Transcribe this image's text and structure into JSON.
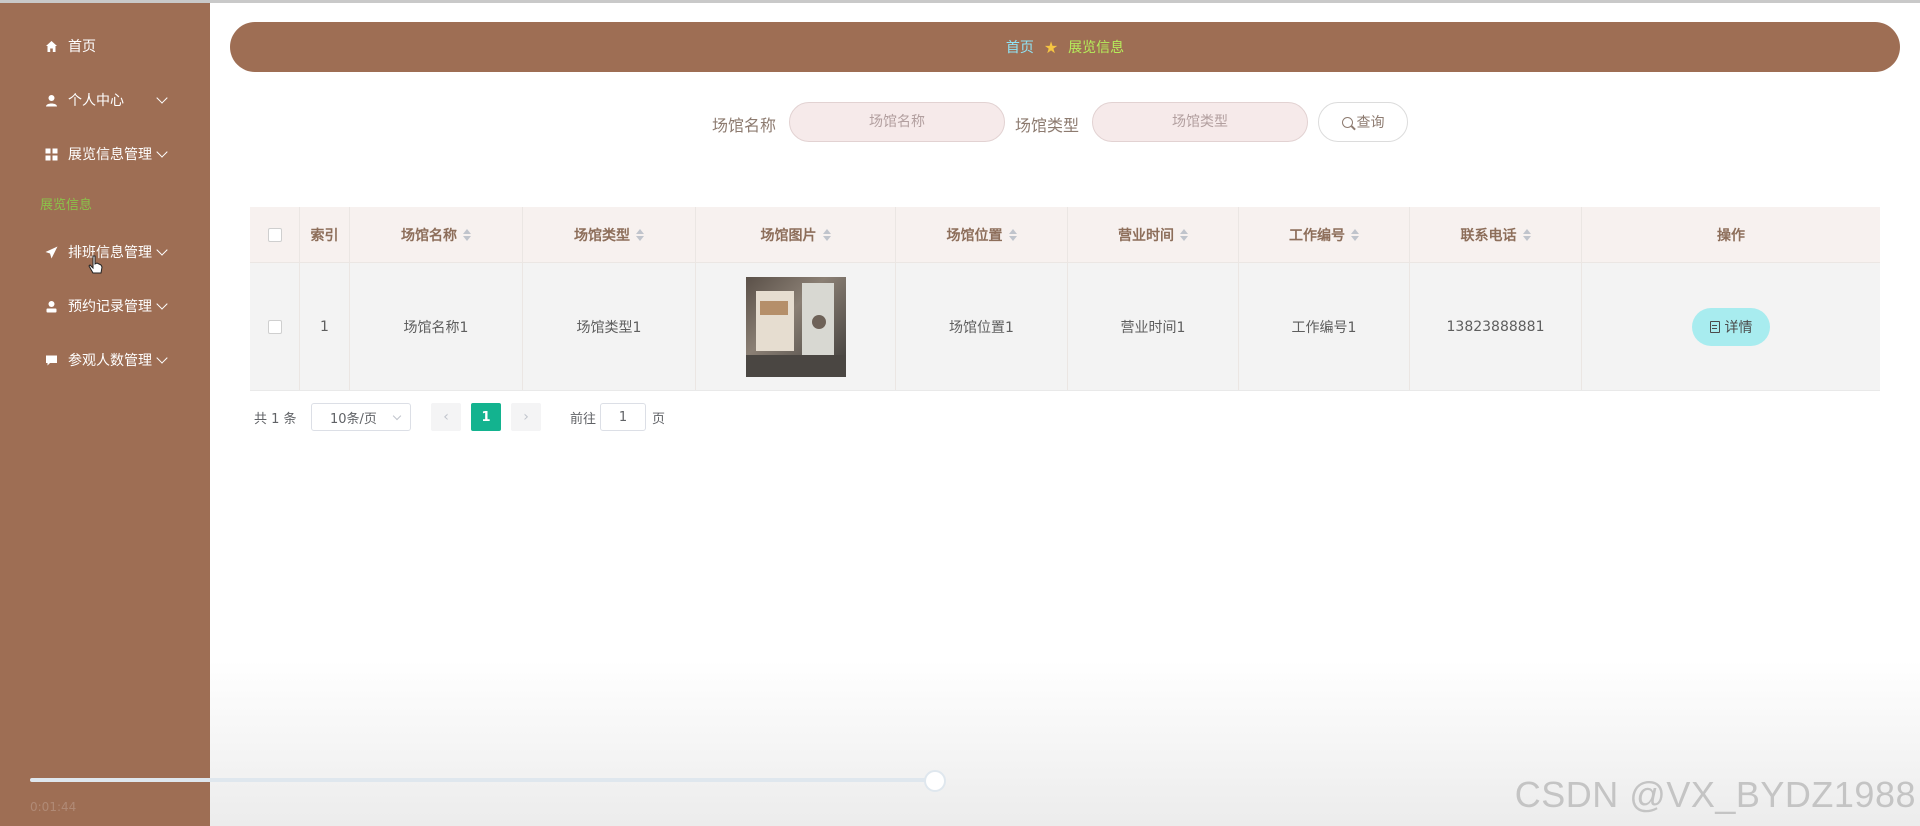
{
  "sidebar": {
    "items": [
      {
        "label": "首页",
        "icon": "home-icon"
      },
      {
        "label": "个人中心",
        "icon": "user-icon"
      },
      {
        "label": "展览信息管理",
        "icon": "grid-icon"
      },
      {
        "label": "排班信息管理",
        "icon": "send-icon"
      },
      {
        "label": "预约记录管理",
        "icon": "person-icon"
      },
      {
        "label": "参观人数管理",
        "icon": "chat-icon"
      }
    ],
    "active_sub_item": "展览信息",
    "colors": {
      "background": "#9e6e54",
      "active": "#8bc34a"
    }
  },
  "breadcrumb": {
    "home": "首页",
    "star": "★",
    "current": "展览信息"
  },
  "search": {
    "name_label": "场馆名称",
    "name_placeholder": "场馆名称",
    "type_label": "场馆类型",
    "type_placeholder": "场馆类型",
    "button": "查询"
  },
  "table": {
    "headers": [
      "索引",
      "场馆名称",
      "场馆类型",
      "场馆图片",
      "场馆位置",
      "营业时间",
      "工作编号",
      "联系电话",
      "操作"
    ],
    "rows": [
      {
        "index": "1",
        "name": "场馆名称1",
        "type": "场馆类型1",
        "image": "venue-photo",
        "location": "场馆位置1",
        "hours": "营业时间1",
        "work_no": "工作编号1",
        "phone": "13823888881",
        "action": "详情"
      }
    ]
  },
  "pagination": {
    "total": "共 1 条",
    "page_size": "10条/页",
    "current_page": "1",
    "goto_label": "前往",
    "goto_value": "1",
    "page_suffix": "页",
    "accent": "#13b38f"
  },
  "player": {
    "time": "0:01:44",
    "progress": 0.46
  },
  "watermark": "CSDN @VX_BYDZ1988"
}
